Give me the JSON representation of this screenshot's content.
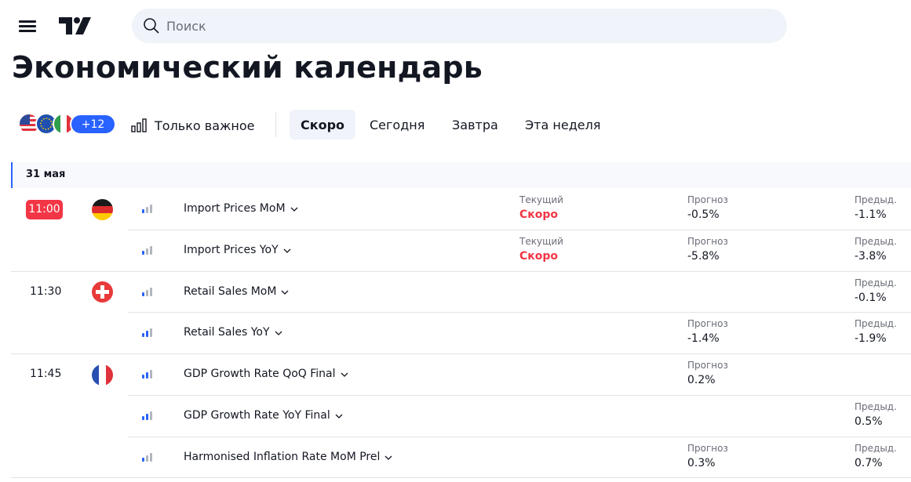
{
  "header": {
    "search_placeholder": "Поиск",
    "page_title": "Экономический календарь"
  },
  "filters": {
    "countries_more": "+12",
    "only_important": "Только важное",
    "tabs": [
      "Скоро",
      "Сегодня",
      "Завтра",
      "Эта неделя"
    ],
    "active_tab": "Скоро"
  },
  "date_label": "31 мая",
  "labels": {
    "current": "Текущий",
    "forecast": "Прогноз",
    "previous": "Предыд."
  },
  "events": [
    {
      "time": "11:00",
      "country": "DE",
      "name": "Import Prices MoM",
      "importance": 1,
      "current": "Скоро",
      "forecast": "-0.5%",
      "previous": "-1.1%"
    },
    {
      "time": "",
      "country": "",
      "name": "Import Prices YoY",
      "importance": 1,
      "current": "Скоро",
      "forecast": "-5.8%",
      "previous": "-3.8%"
    },
    {
      "time": "11:30",
      "country": "CH",
      "name": "Retail Sales MoM",
      "importance": 1,
      "current": "",
      "forecast": "",
      "previous": "-0.1%"
    },
    {
      "time": "",
      "country": "",
      "name": "Retail Sales YoY",
      "importance": 2,
      "current": "",
      "forecast": "-1.4%",
      "previous": "-1.9%"
    },
    {
      "time": "11:45",
      "country": "FR",
      "name": "GDP Growth Rate QoQ Final",
      "importance": 2,
      "current": "",
      "forecast": "0.2%",
      "previous": ""
    },
    {
      "time": "",
      "country": "",
      "name": "GDP Growth Rate YoY Final",
      "importance": 2,
      "current": "",
      "forecast": "",
      "previous": "0.5%"
    },
    {
      "time": "",
      "country": "",
      "name": "Harmonised Inflation Rate MoM Prel",
      "importance": 1,
      "current": "",
      "forecast": "0.3%",
      "previous": "0.7%"
    }
  ],
  "colors": {
    "accent": "#2962ff",
    "danger": "#f23645",
    "importance_on": "#2962ff",
    "importance_off": "#b2b5be"
  }
}
